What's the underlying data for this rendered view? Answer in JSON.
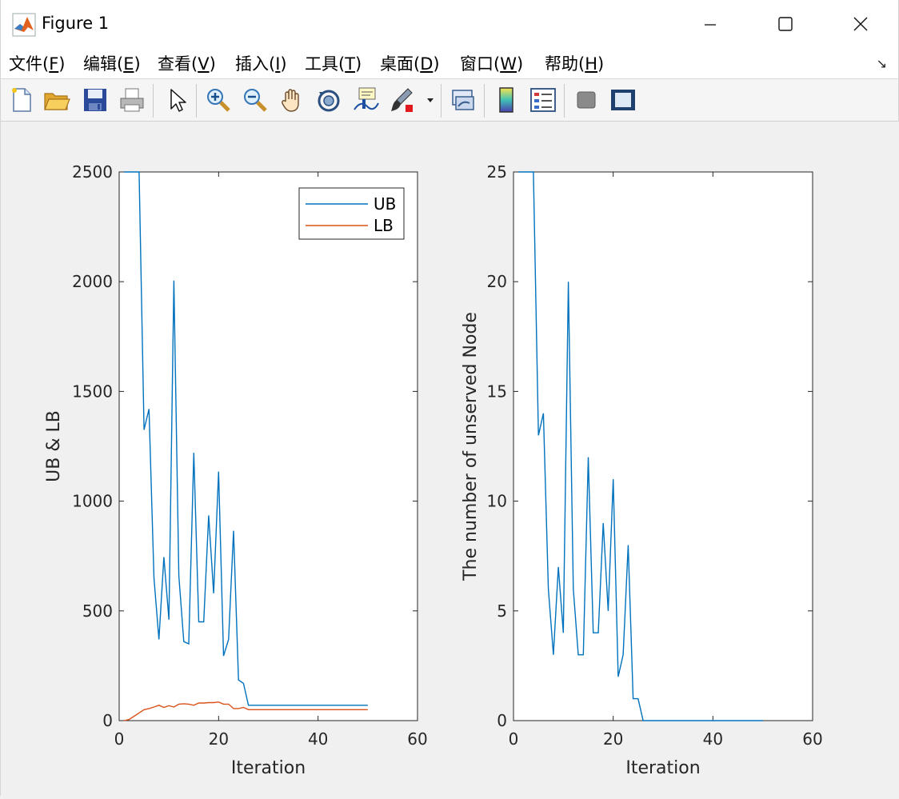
{
  "window": {
    "title": "Figure 1"
  },
  "menu": [
    {
      "pre": "文件(",
      "key": "F",
      "post": ")"
    },
    {
      "pre": "编辑(",
      "key": "E",
      "post": ")"
    },
    {
      "pre": "查看(",
      "key": "V",
      "post": ")"
    },
    {
      "pre": "插入(",
      "key": "I",
      "post": ")"
    },
    {
      "pre": "工具(",
      "key": "T",
      "post": ")"
    },
    {
      "pre": "桌面(",
      "key": "D",
      "post": ")"
    },
    {
      "pre": "窗口(",
      "key": "W",
      "post": ")"
    },
    {
      "pre": "帮助(",
      "key": "H",
      "post": ")"
    }
  ],
  "toolbar": [
    "new-figure-icon",
    "open-folder-icon",
    "save-icon",
    "print-icon",
    "pointer-icon",
    "zoom-in-icon",
    "zoom-out-icon",
    "pan-hand-icon",
    "rotate-3d-icon",
    "data-cursor-icon",
    "brush-icon",
    "link-plot-icon",
    "colorbar-icon",
    "legend-icon",
    "hide-plot-tools-icon",
    "show-plot-tools-icon"
  ],
  "colors": {
    "ub": "#0072bd",
    "lb": "#d95319"
  },
  "chart_data": [
    {
      "type": "line",
      "xlabel": "Iteration",
      "ylabel": "UB & LB",
      "xlim": [
        0,
        60
      ],
      "ylim": [
        0,
        2500
      ],
      "xticks": [
        "0",
        "20",
        "40",
        "60"
      ],
      "yticks": [
        "0",
        "500",
        "1000",
        "1500",
        "2000",
        "2500"
      ],
      "legend": "top-right",
      "grid": false,
      "series": [
        {
          "name": "UB",
          "color": "#0072bd",
          "x": [
            1,
            2,
            3,
            4,
            5,
            6,
            7,
            8,
            9,
            10,
            11,
            12,
            13,
            14,
            15,
            16,
            17,
            18,
            19,
            20,
            21,
            22,
            23,
            24,
            25,
            26,
            27,
            30,
            35,
            40,
            45,
            50
          ],
          "y": [
            2500,
            2500,
            2500,
            2500,
            1325,
            1420,
            650,
            370,
            745,
            460,
            2005,
            660,
            360,
            350,
            1220,
            450,
            450,
            935,
            580,
            1135,
            295,
            370,
            865,
            185,
            170,
            70,
            70,
            70,
            70,
            70,
            70,
            70
          ]
        },
        {
          "name": "LB",
          "color": "#d95319",
          "x": [
            1,
            2,
            3,
            4,
            5,
            6,
            7,
            8,
            9,
            10,
            11,
            12,
            13,
            14,
            15,
            16,
            17,
            18,
            19,
            20,
            21,
            22,
            23,
            24,
            25,
            26,
            27,
            30,
            35,
            40,
            45,
            50
          ],
          "y": [
            0,
            5,
            20,
            35,
            50,
            55,
            62,
            70,
            60,
            68,
            62,
            75,
            77,
            75,
            70,
            80,
            80,
            82,
            82,
            85,
            75,
            75,
            55,
            55,
            60,
            50,
            50,
            50,
            50,
            50,
            50,
            50
          ]
        }
      ]
    },
    {
      "type": "line",
      "xlabel": "Iteration",
      "ylabel": "The number of unserved Node",
      "xlim": [
        0,
        60
      ],
      "ylim": [
        0,
        25
      ],
      "xticks": [
        "0",
        "20",
        "40",
        "60"
      ],
      "yticks": [
        "0",
        "5",
        "10",
        "15",
        "20",
        "25"
      ],
      "grid": false,
      "series": [
        {
          "color": "#0072bd",
          "x": [
            1,
            2,
            3,
            4,
            5,
            6,
            7,
            8,
            9,
            10,
            11,
            12,
            13,
            14,
            15,
            16,
            17,
            18,
            19,
            20,
            21,
            22,
            23,
            24,
            25,
            26,
            27,
            30,
            35,
            40,
            45,
            50
          ],
          "y": [
            25,
            25,
            25,
            25,
            13,
            14,
            6,
            3,
            7,
            4,
            20,
            6,
            3,
            3,
            12,
            4,
            4,
            9,
            5,
            11,
            2,
            3,
            8,
            1,
            1,
            0,
            0,
            0,
            0,
            0,
            0,
            0
          ]
        }
      ]
    }
  ]
}
